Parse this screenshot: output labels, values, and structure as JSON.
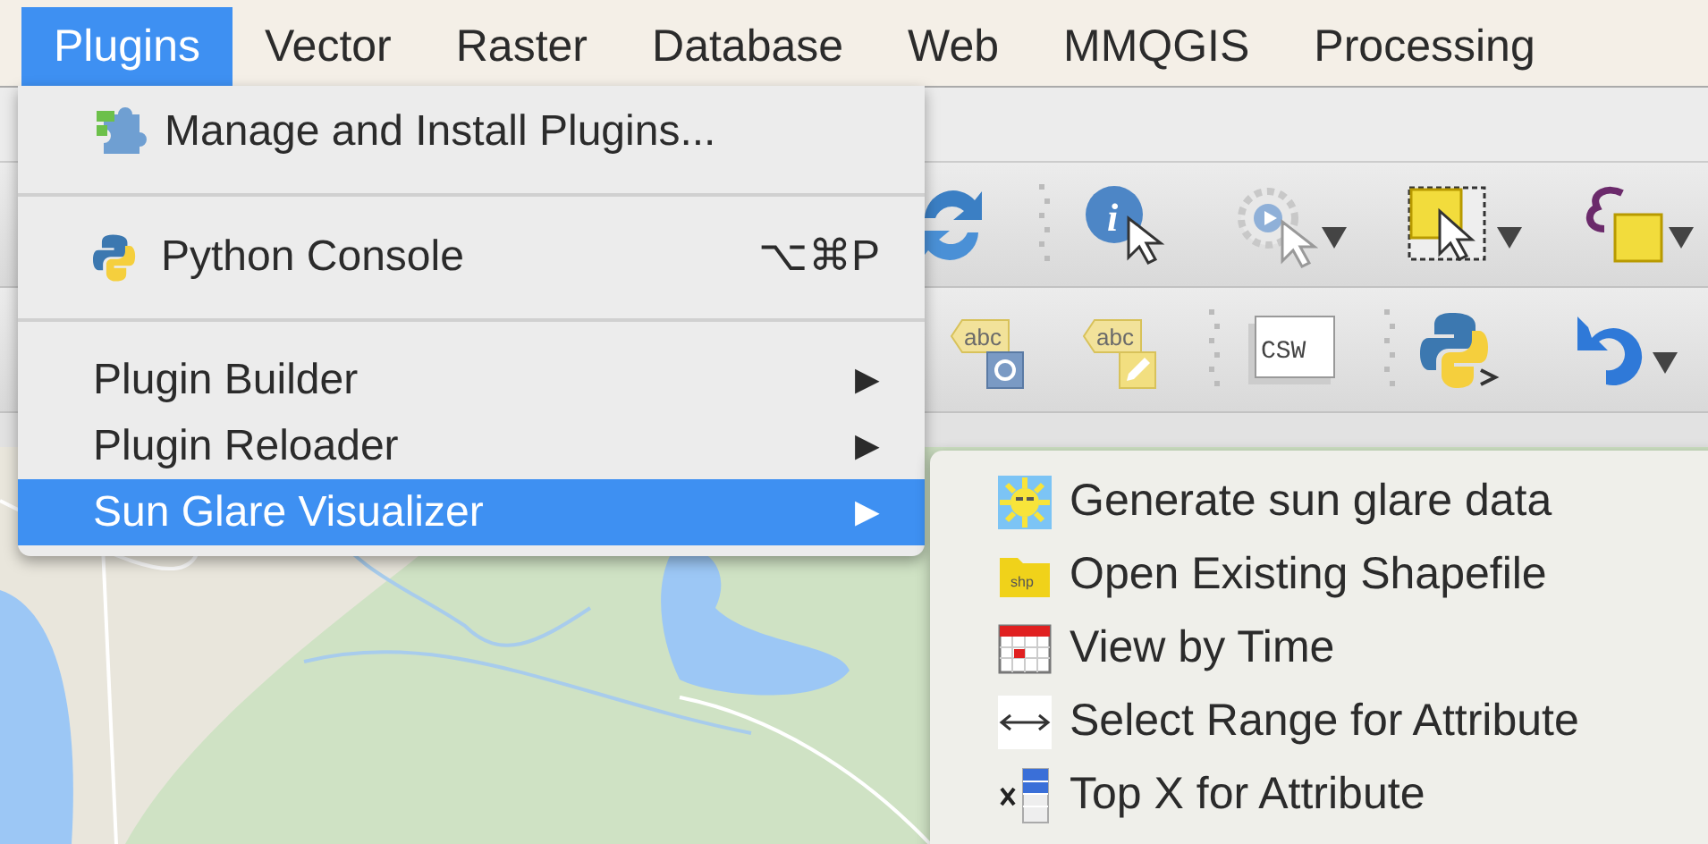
{
  "menu_bar": [
    {
      "label": "Plugins",
      "selected": true
    },
    {
      "label": "Vector",
      "selected": false
    },
    {
      "label": "Raster",
      "selected": false
    },
    {
      "label": "Database",
      "selected": false
    },
    {
      "label": "Web",
      "selected": false
    },
    {
      "label": "MMQGIS",
      "selected": false
    },
    {
      "label": "Processing",
      "selected": false
    }
  ],
  "plugins_menu": [
    {
      "kind": "item",
      "label": "Manage and Install Plugins...",
      "selected": false
    },
    {
      "kind": "separator"
    },
    {
      "kind": "item",
      "label": "Python Console",
      "shortcut": "⌥⌘P",
      "selected": false
    },
    {
      "kind": "separator"
    },
    {
      "kind": "submenu",
      "label": "Plugin Builder",
      "arrow": "▶",
      "selected": false
    },
    {
      "kind": "submenu",
      "label": "Plugin Reloader",
      "arrow": "▶",
      "selected": false
    },
    {
      "kind": "submenu",
      "label": "Sun Glare Visualizer",
      "arrow": "▶",
      "selected": true
    }
  ],
  "toolbar_icon_texts": {
    "identify": "i",
    "label_tools": [
      "abc",
      "abc"
    ],
    "catalog": "CSW"
  },
  "sun_glare_submenu": [
    {
      "label": "Generate sun glare data"
    },
    {
      "label": "Open Existing Shapefile",
      "icon_text": "shp"
    },
    {
      "label": "View by Time"
    },
    {
      "label": "Select Range for Attribute"
    },
    {
      "label": "Top X for Attribute"
    }
  ]
}
